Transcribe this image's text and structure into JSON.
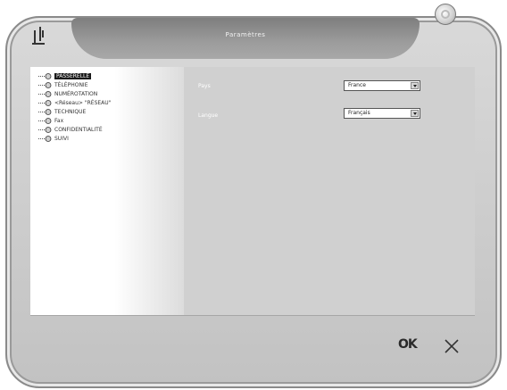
{
  "window": {
    "title": "Paramètres",
    "close_icon": "close-circle-icon",
    "app_icon": "settings-app-icon"
  },
  "tree": {
    "items": [
      {
        "label": "PASSERELLE",
        "selected": true,
        "icon": "node-icon"
      },
      {
        "label": "TÉLÉPHONIE",
        "selected": false,
        "icon": "node-icon"
      },
      {
        "label": "NUMÉROTATION",
        "selected": false,
        "icon": "node-icon"
      },
      {
        "label": "<Réseau> \"RÉSEAU\"",
        "selected": false,
        "icon": "node-icon"
      },
      {
        "label": "TECHNIQUE",
        "selected": false,
        "icon": "node-icon"
      },
      {
        "label": "Fax",
        "selected": false,
        "icon": "node-icon"
      },
      {
        "label": "CONFIDENTIALITÉ",
        "selected": false,
        "icon": "node-icon"
      },
      {
        "label": "SUIVI",
        "selected": false,
        "icon": "node-icon"
      }
    ]
  },
  "form": {
    "fields": [
      {
        "label": "Pays",
        "value": "France"
      },
      {
        "label": "Langue",
        "value": "Français"
      }
    ]
  },
  "buttons": {
    "ok_label": "OK",
    "cancel_icon": "close-x-icon"
  }
}
